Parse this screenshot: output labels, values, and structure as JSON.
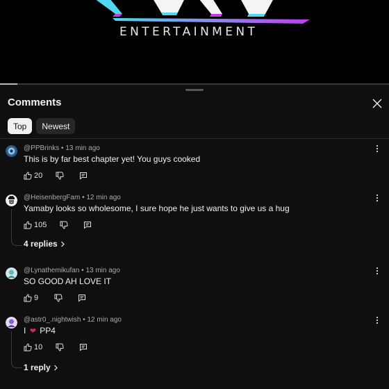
{
  "video": {
    "brand_text": "ENTERTAINMENT",
    "progress_fraction": 0.045
  },
  "panel": {
    "title": "Comments",
    "sort_tabs": [
      {
        "label": "Top",
        "active": true
      },
      {
        "label": "Newest",
        "active": false
      }
    ]
  },
  "comments": [
    {
      "author": "@PPBrinks",
      "time": "13 min ago",
      "text": "This is by far best chapter yet! You guys cooked",
      "likes": "20",
      "replies_label": ""
    },
    {
      "author": "@HeisenbergFam",
      "time": "12 min ago",
      "text": "Yamaby looks so wholesome, I sure hope he just wants to give us a hug",
      "likes": "105",
      "replies_label": "4 replies"
    },
    {
      "author": "@Lynathemikufan",
      "time": "13 min ago",
      "text": "SO GOOD AH LOVE IT",
      "likes": "9",
      "replies_label": ""
    },
    {
      "author": "@astr0_.nightwish",
      "time": "12 min ago",
      "text_before_heart": "I",
      "text_after_heart": "PP4",
      "likes": "10",
      "replies_label": "1 reply"
    }
  ],
  "colors": {
    "background": "#0f0f0f",
    "heart": "#e0245e",
    "logo_cyan": "#4fd8f0",
    "logo_magenta": "#c23cf0"
  }
}
